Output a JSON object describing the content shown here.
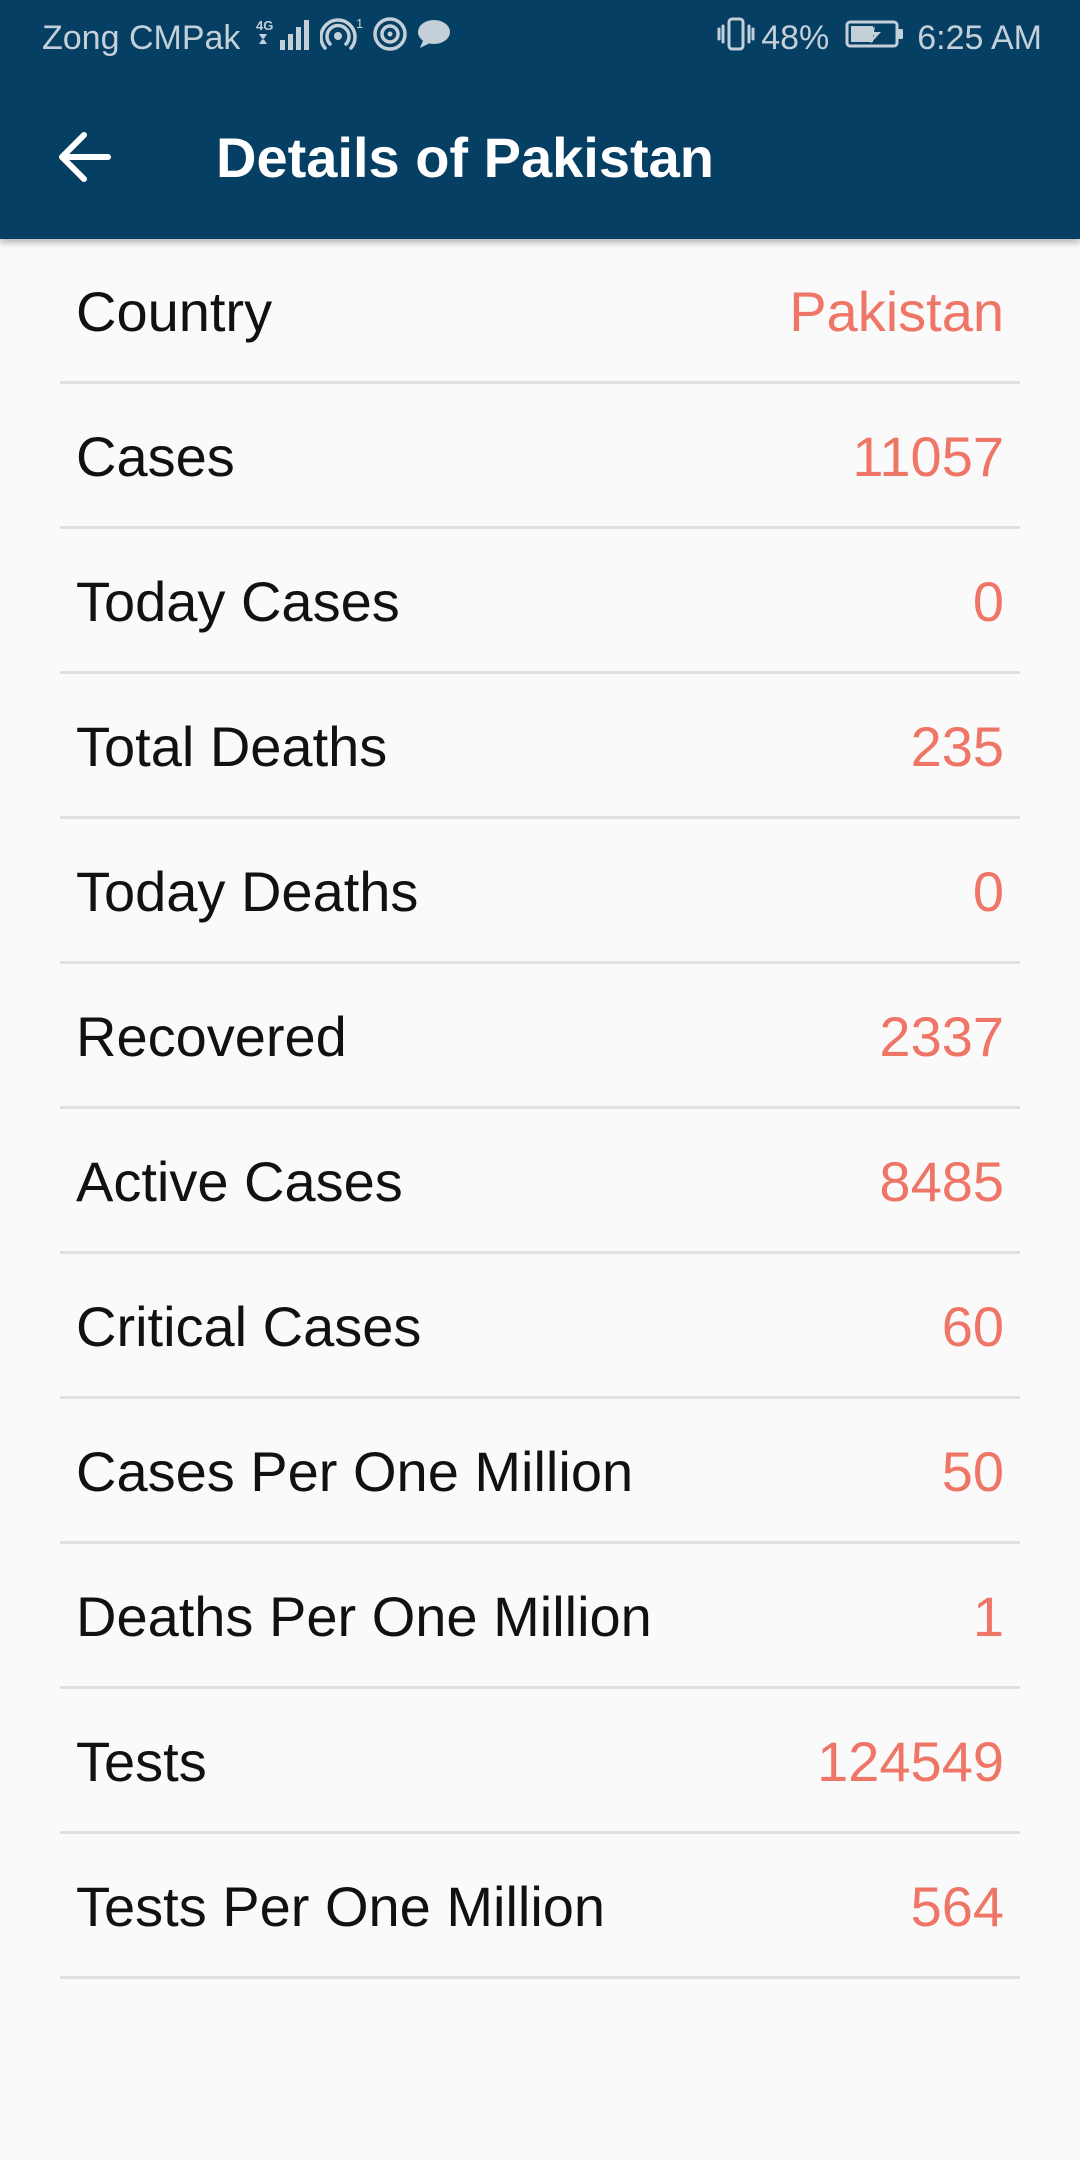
{
  "status_bar": {
    "carrier": "Zong CMPak",
    "network": "4G",
    "battery": "48%",
    "time": "6:25 AM",
    "icons": [
      "signal-icon",
      "hotspot-icon",
      "nfc-icon",
      "message-icon",
      "vibrate-icon",
      "battery-charging-icon"
    ]
  },
  "app_bar": {
    "title": "Details of Pakistan",
    "back_icon": "arrow-left-icon"
  },
  "details": [
    {
      "label": "Country",
      "value": "Pakistan"
    },
    {
      "label": "Cases",
      "value": "11057"
    },
    {
      "label": "Today Cases",
      "value": "0"
    },
    {
      "label": "Total Deaths",
      "value": "235"
    },
    {
      "label": "Today Deaths",
      "value": "0"
    },
    {
      "label": "Recovered",
      "value": "2337"
    },
    {
      "label": "Active Cases",
      "value": "8485"
    },
    {
      "label": "Critical Cases",
      "value": "60"
    },
    {
      "label": "Cases Per One Million",
      "value": "50"
    },
    {
      "label": "Deaths Per One Million",
      "value": "1"
    },
    {
      "label": "Tests",
      "value": "124549"
    },
    {
      "label": "Tests Per One Million",
      "value": "564"
    }
  ],
  "colors": {
    "primary": "#053f63",
    "value_accent": "#ef7566",
    "divider": "#e0e0e0",
    "background": "#fafafa"
  }
}
